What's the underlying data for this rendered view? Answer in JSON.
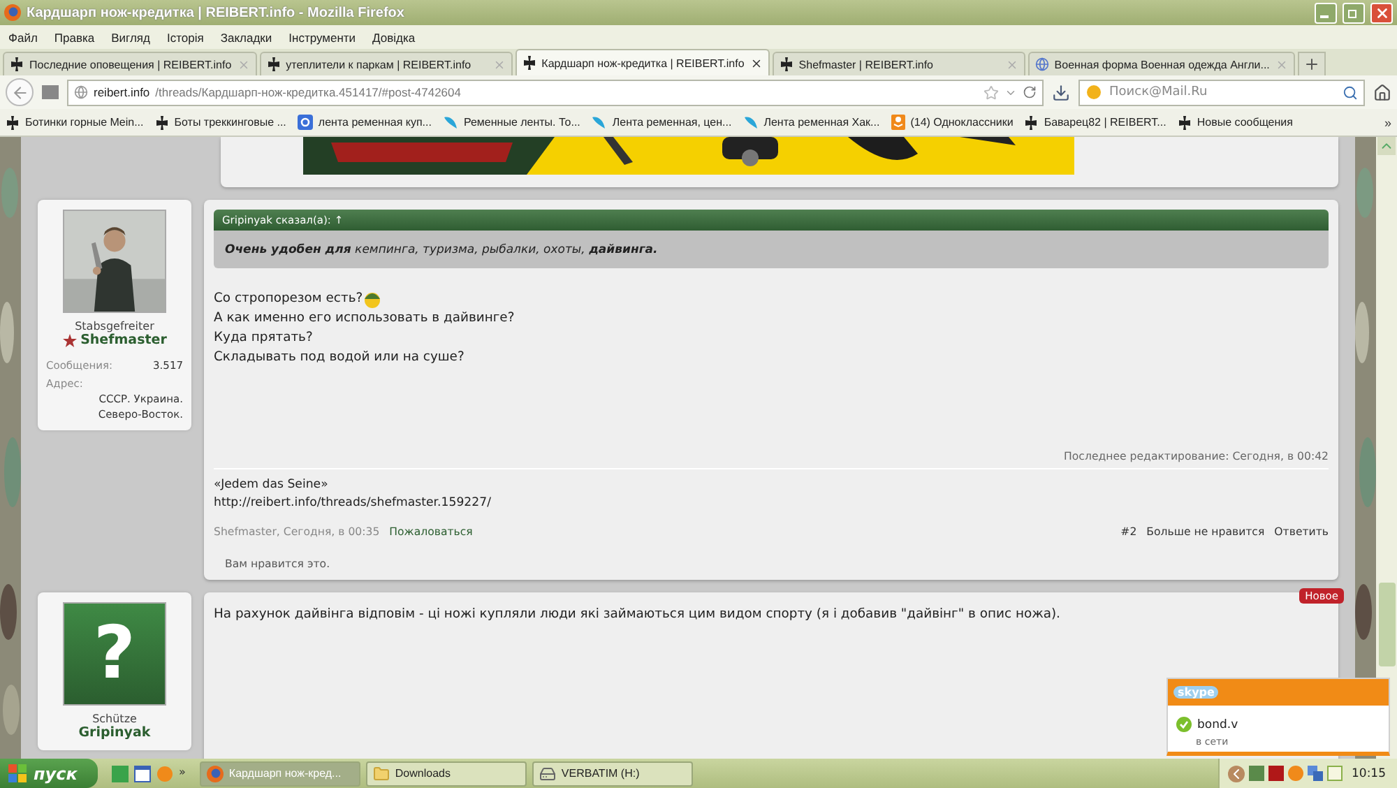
{
  "window": {
    "title": "Кардшарп нож-кредитка | REIBERT.info - Mozilla Firefox"
  },
  "menu": [
    "Файл",
    "Правка",
    "Вигляд",
    "Історія",
    "Закладки",
    "Інструменти",
    "Довідка"
  ],
  "tabs": [
    {
      "label": "Последние оповещения | REIBERT.info",
      "selected": false,
      "kind": "cross"
    },
    {
      "label": "утеплители к паркам | REIBERT.info",
      "selected": false,
      "kind": "cross"
    },
    {
      "label": "Кардшарп нож-кредитка | REIBERT.info",
      "selected": true,
      "kind": "cross"
    },
    {
      "label": "Shefmaster | REIBERT.info",
      "selected": false,
      "kind": "cross"
    },
    {
      "label": "Военная форма Военная одежда Англи...",
      "selected": false,
      "kind": "globe"
    }
  ],
  "address": {
    "host": "reibert.info",
    "path": "/threads/Кардшарп-нож-кредитка.451417/#post-4742604"
  },
  "search": {
    "placeholder": "Поиск@Mail.Ru"
  },
  "bookmarks": [
    {
      "label": "Ботинки горные Mein...",
      "kind": "cross"
    },
    {
      "label": "Боты треккинговые ...",
      "kind": "cross"
    },
    {
      "label": "лента ременная куп...",
      "kind": "google"
    },
    {
      "label": "Ременные ленты. То...",
      "kind": "feather"
    },
    {
      "label": "Лента ременная, цен...",
      "kind": "feather"
    },
    {
      "label": "Лента ременная Хак...",
      "kind": "feather"
    },
    {
      "label": "(14) Одноклассники",
      "kind": "ok"
    },
    {
      "label": "Баварец82 | REIBERT...",
      "kind": "cross"
    },
    {
      "label": "Новые сообщения",
      "kind": "cross"
    }
  ],
  "bookmarks_more": "»",
  "posts": [
    {
      "author": {
        "rank": "Stabsgefreiter",
        "name": "Shefmaster",
        "stats": [
          {
            "label": "Сообщения:",
            "value": "3.517"
          }
        ],
        "address_label": "Адрес:",
        "address": [
          "СССР. Украина.",
          "Северо-Восток."
        ]
      },
      "quote": {
        "header": "Gripinyak сказал(а): ↑",
        "text": "**Очень удобен для** кемпинга, туризма, рыбалки, охоты, **дайвинга.**"
      },
      "lines": [
        "Со стропорезом есть?",
        "А как именно его использовать в дайвинге?",
        "Куда прятать?",
        "Складывать под водой или на суше?"
      ],
      "edited": "Последнее редактирование: Сегодня, в 00:42",
      "signature": [
        "«Jedem das Seine»",
        "http://reibert.info/threads/shefmaster.159227/"
      ],
      "meta": {
        "author_date": "Shefmaster, Сегодня, в 00:35",
        "report": "Пожаловаться",
        "number": "#2",
        "actions": [
          "Больше не нравится",
          "Ответить"
        ]
      },
      "likes": "Вам нравится это."
    },
    {
      "author": {
        "avatar_glyph": "?",
        "rank": "Schütze",
        "name": "Gripinyak"
      },
      "badge": "Новое",
      "lines": [
        "На рахунок дайвінга відповім - ці ножі купляли люди які займаються цим видом спорту (я і добавив \"дайвінг\" в опис ножа)."
      ]
    }
  ],
  "skype": {
    "logo": "skype",
    "contact": "bond.v",
    "status": "в сети"
  },
  "taskbar": {
    "start": "пуск",
    "more": "»",
    "tasks": [
      {
        "label": "Кардшарп нож-кред...",
        "selected": true,
        "kind": "firefox"
      },
      {
        "label": "Downloads",
        "selected": false,
        "kind": "folder"
      },
      {
        "label": "VERBATIM (H:)",
        "selected": false,
        "kind": "drive"
      }
    ],
    "time": "10:15"
  }
}
